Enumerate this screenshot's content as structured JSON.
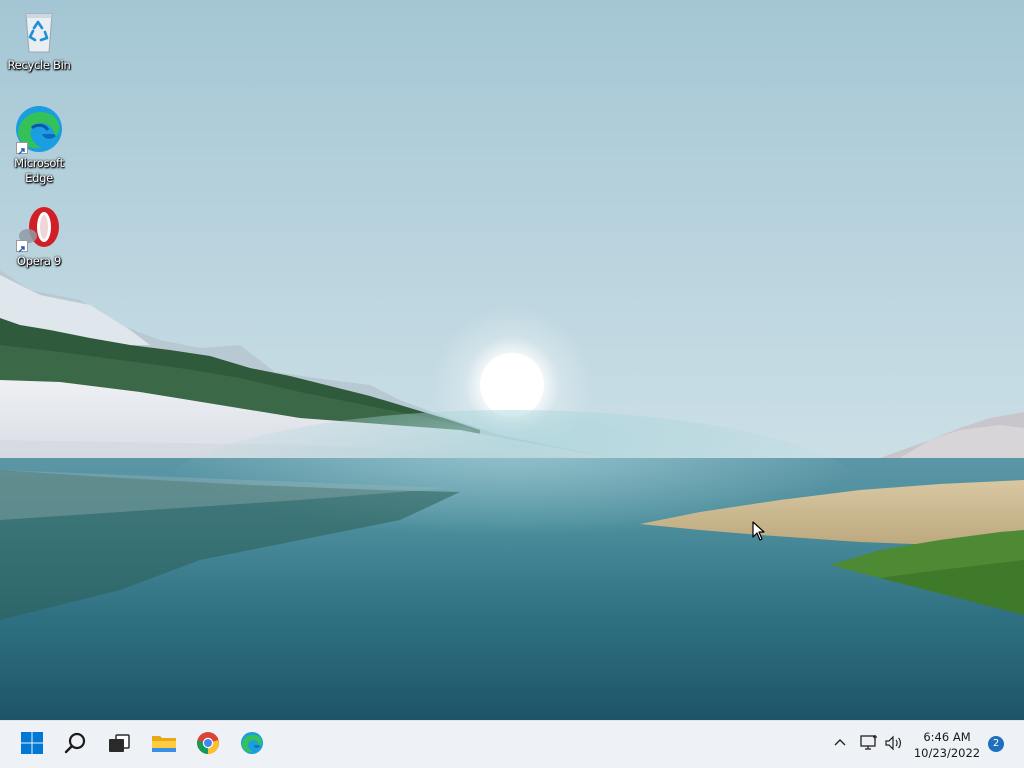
{
  "desktop": {
    "icons": [
      {
        "label": "Recycle Bin",
        "icon": "recycle-bin-icon",
        "shortcut": false
      },
      {
        "label": "Microsoft Edge",
        "icon": "edge-icon",
        "shortcut": true
      },
      {
        "label": "Opera 9",
        "icon": "opera-icon",
        "shortcut": true
      }
    ]
  },
  "taskbar": {
    "pinned": [
      {
        "name": "Start",
        "icon": "windows-start-icon"
      },
      {
        "name": "Search",
        "icon": "search-icon"
      },
      {
        "name": "Task View",
        "icon": "task-view-icon"
      },
      {
        "name": "File Explorer",
        "icon": "file-explorer-icon"
      },
      {
        "name": "Google Chrome",
        "icon": "chrome-icon"
      },
      {
        "name": "Microsoft Edge",
        "icon": "edge-icon"
      }
    ],
    "tray": {
      "icons": [
        "chevron-up-icon",
        "network-icon",
        "volume-icon"
      ],
      "time": "6:46 AM",
      "date": "10/23/2022",
      "notification_count": "2"
    }
  },
  "colors": {
    "taskbar_bg": "#eef1f5",
    "accent": "#0078d4",
    "badge": "#1f6fbf"
  }
}
